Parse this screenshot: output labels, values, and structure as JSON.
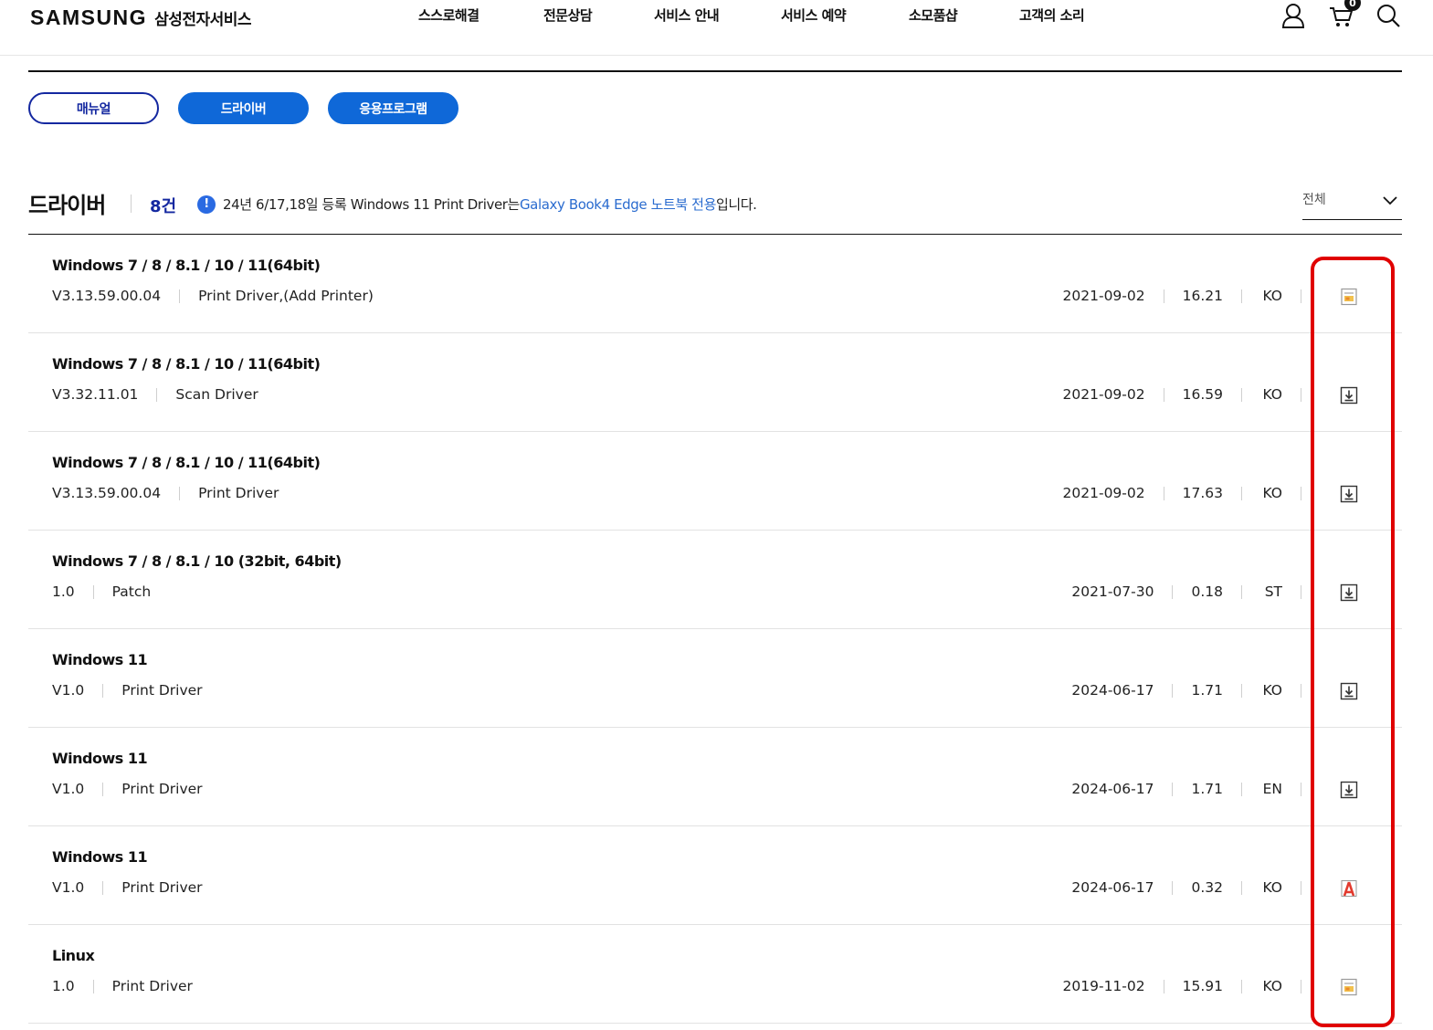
{
  "header": {
    "logo_brand": "SAMSUNG",
    "logo_sub": "삼성전자서비스",
    "nav": [
      "스스로해결",
      "전문상담",
      "서비스 안내",
      "서비스 예약",
      "소모품샵",
      "고객의 소리"
    ],
    "cart_count": "0",
    "icons": [
      "user-icon",
      "cart-icon",
      "search-icon"
    ]
  },
  "tabs": [
    "매뉴얼",
    "드라이버",
    "응용프로그램"
  ],
  "section": {
    "title": "드라이버",
    "count": "8건",
    "notice_prefix": "24년 6/17,18일 등록 Windows 11 Print Driver는 ",
    "notice_highlight": "Galaxy Book4 Edge 노트북 전용",
    "notice_suffix": "입니다.",
    "filter_label": "전체"
  },
  "rows": [
    {
      "os": "Windows 7 / 8 / 8.1 / 10 / 11(64bit)",
      "version": "V3.13.59.00.04",
      "type": "Print Driver,(Add Printer)",
      "date": "2021-09-02",
      "size": "16.21",
      "lang": "KO",
      "icon": "install-file-icon"
    },
    {
      "os": "Windows 7 / 8 / 8.1 / 10 / 11(64bit)",
      "version": "V3.32.11.01",
      "type": "Scan Driver",
      "date": "2021-09-02",
      "size": "16.59",
      "lang": "KO",
      "icon": "download-icon"
    },
    {
      "os": "Windows 7 / 8 / 8.1 / 10 / 11(64bit)",
      "version": "V3.13.59.00.04",
      "type": "Print Driver",
      "date": "2021-09-02",
      "size": "17.63",
      "lang": "KO",
      "icon": "download-icon"
    },
    {
      "os": "Windows 7 / 8 / 8.1 / 10 (32bit, 64bit)",
      "version": "1.0",
      "type": "Patch",
      "date": "2021-07-30",
      "size": "0.18",
      "lang": "ST",
      "icon": "download-icon"
    },
    {
      "os": "Windows 11",
      "version": "V1.0",
      "type": "Print Driver",
      "date": "2024-06-17",
      "size": "1.71",
      "lang": "KO",
      "icon": "download-icon"
    },
    {
      "os": "Windows 11",
      "version": "V1.0",
      "type": "Print Driver",
      "date": "2024-06-17",
      "size": "1.71",
      "lang": "EN",
      "icon": "download-icon"
    },
    {
      "os": "Windows 11",
      "version": "V1.0",
      "type": "Print Driver",
      "date": "2024-06-17",
      "size": "0.32",
      "lang": "KO",
      "icon": "pdf-icon"
    },
    {
      "os": "Linux",
      "version": "1.0",
      "type": "Print Driver",
      "date": "2019-11-02",
      "size": "15.91",
      "lang": "KO",
      "icon": "install-file-icon"
    }
  ],
  "colors": {
    "brand_navy": "#1428a0",
    "accent_blue": "#0f68d8",
    "link_blue": "#2b6ccf",
    "highlight_red": "#e00000",
    "pdf_red": "#e23a2e"
  }
}
